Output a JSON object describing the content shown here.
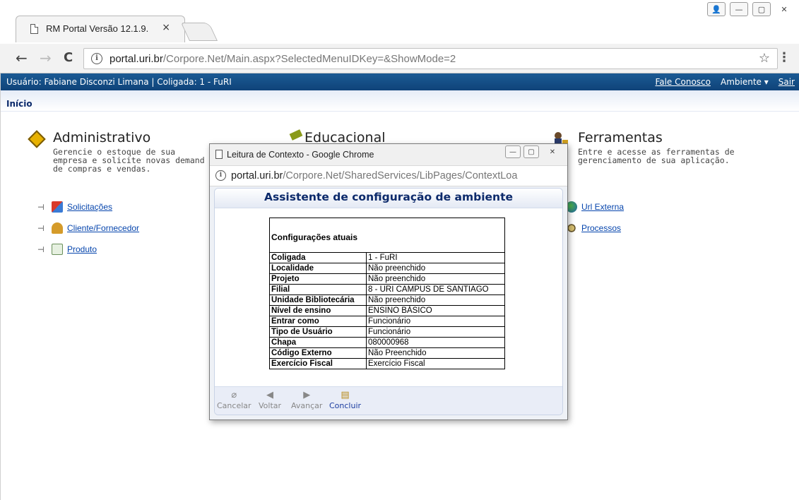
{
  "browser": {
    "tab_title": "RM Portal Versão 12.1.9.",
    "tab_close": "×",
    "url_host": "portal.uri.br",
    "url_path": "/Corpore.Net/Main.aspx?SelectedMenuIDKey=&ShowMode=2",
    "info_glyph": "i",
    "back_glyph": "←",
    "forward_glyph": "→",
    "reload_glyph": "C",
    "star_glyph": "☆",
    "menu_glyph": "⋮",
    "winctrl_user": "👤",
    "winctrl_min": "—",
    "winctrl_max": "▢",
    "winctrl_close": "✕"
  },
  "header": {
    "user_label": "Usuário: Fabiane Disconzi Limana  |  Coligada: 1 - FuRI",
    "contact_link": "Fale Conosco",
    "environment_menu": "Ambiente ▾",
    "logout_link": "Sair"
  },
  "breadcrumb": {
    "label": "Início"
  },
  "modules": {
    "admin": {
      "title": "Administrativo",
      "desc": "Gerencie o estoque de sua\nempresa e solicite novas demand\nde compras e vendas.",
      "items": [
        "Solicitações",
        "Cliente/Fornecedor",
        "Produto"
      ]
    },
    "edu": {
      "title": "Educacional"
    },
    "tools": {
      "title": "Ferramentas",
      "desc": "Entre e acesse as ferramentas de\ngerenciamento de sua aplicação.",
      "items": [
        "Url Externa",
        "Processos"
      ]
    },
    "pin_glyph": "⊣"
  },
  "popup": {
    "title": "Leitura de Contexto - Google Chrome",
    "url_host": "portal.uri.br",
    "url_path": "/Corpore.Net/SharedServices/LibPages/ContextLoa",
    "heading": "Assistente de configuração de ambiente",
    "table_heading": "Configurações atuais",
    "rows": [
      {
        "k": "Coligada",
        "v": "1 - FuRI"
      },
      {
        "k": "Localidade",
        "v": "Não preenchido"
      },
      {
        "k": "Projeto",
        "v": "Não preenchido"
      },
      {
        "k": "Filial",
        "v": "8 - URI CAMPUS DE SANTIAGO"
      },
      {
        "k": "Unidade Bibliotecária",
        "v": "Não preenchido"
      },
      {
        "k": "Nível de ensino",
        "v": "ENSINO BÁSICO"
      },
      {
        "k": "Entrar como",
        "v": "Funcionário"
      },
      {
        "k": "Tipo de Usuário",
        "v": "Funcionário"
      },
      {
        "k": "Chapa",
        "v": "080000968"
      },
      {
        "k": "Código Externo",
        "v": "Não Preenchido"
      },
      {
        "k": "Exercício Fiscal",
        "v": "Exercício Fiscal"
      }
    ],
    "buttons": {
      "cancel": "Cancelar",
      "back": "Voltar",
      "next": "Avançar",
      "finish": "Concluir"
    },
    "glyphs": {
      "cancel": "⌀",
      "back": "◀",
      "next": "▶",
      "finish": "▤"
    }
  },
  "colors": {
    "userbar": "#1b5a94",
    "heading": "#0c2a6b",
    "link": "#0645ad"
  }
}
